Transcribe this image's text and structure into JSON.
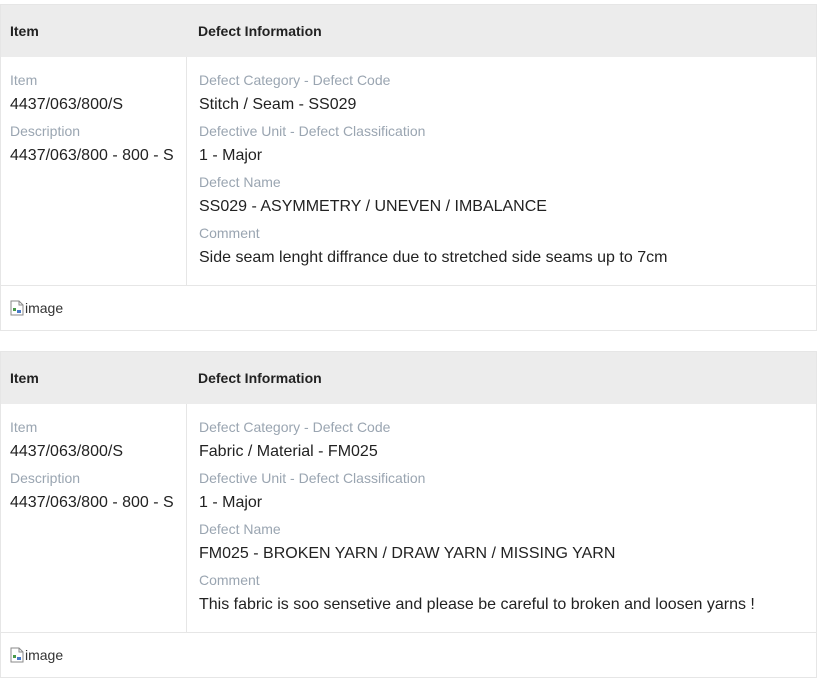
{
  "defects": [
    {
      "header": {
        "item": "Item",
        "defect_info": "Defect Information"
      },
      "item_label": "Item",
      "item_value": "4437/063/800/S",
      "description_label": "Description",
      "description_value": "4437/063/800 - 800 - S",
      "category_label": "Defect Category - Defect Code",
      "category_value": "Stitch / Seam - SS029",
      "unit_label": "Defective Unit - Defect Classification",
      "unit_value": "1 - Major",
      "name_label": "Defect Name",
      "name_value": "SS029 - ASYMMETRY / UNEVEN / IMBALANCE",
      "comment_label": "Comment",
      "comment_value": "Side seam lenght diffrance due to stretched side seams up to 7cm",
      "image_alt": "image"
    },
    {
      "header": {
        "item": "Item",
        "defect_info": "Defect Information"
      },
      "item_label": "Item",
      "item_value": "4437/063/800/S",
      "description_label": "Description",
      "description_value": "4437/063/800 - 800 - S",
      "category_label": "Defect Category - Defect Code",
      "category_value": "Fabric / Material - FM025",
      "unit_label": "Defective Unit - Defect Classification",
      "unit_value": "1 - Major",
      "name_label": "Defect Name",
      "name_value": "FM025 - BROKEN YARN / DRAW YARN / MISSING YARN",
      "comment_label": "Comment",
      "comment_value": "This fabric is soo sensetive and please be careful to broken and loosen yarns !",
      "image_alt": "image"
    }
  ]
}
